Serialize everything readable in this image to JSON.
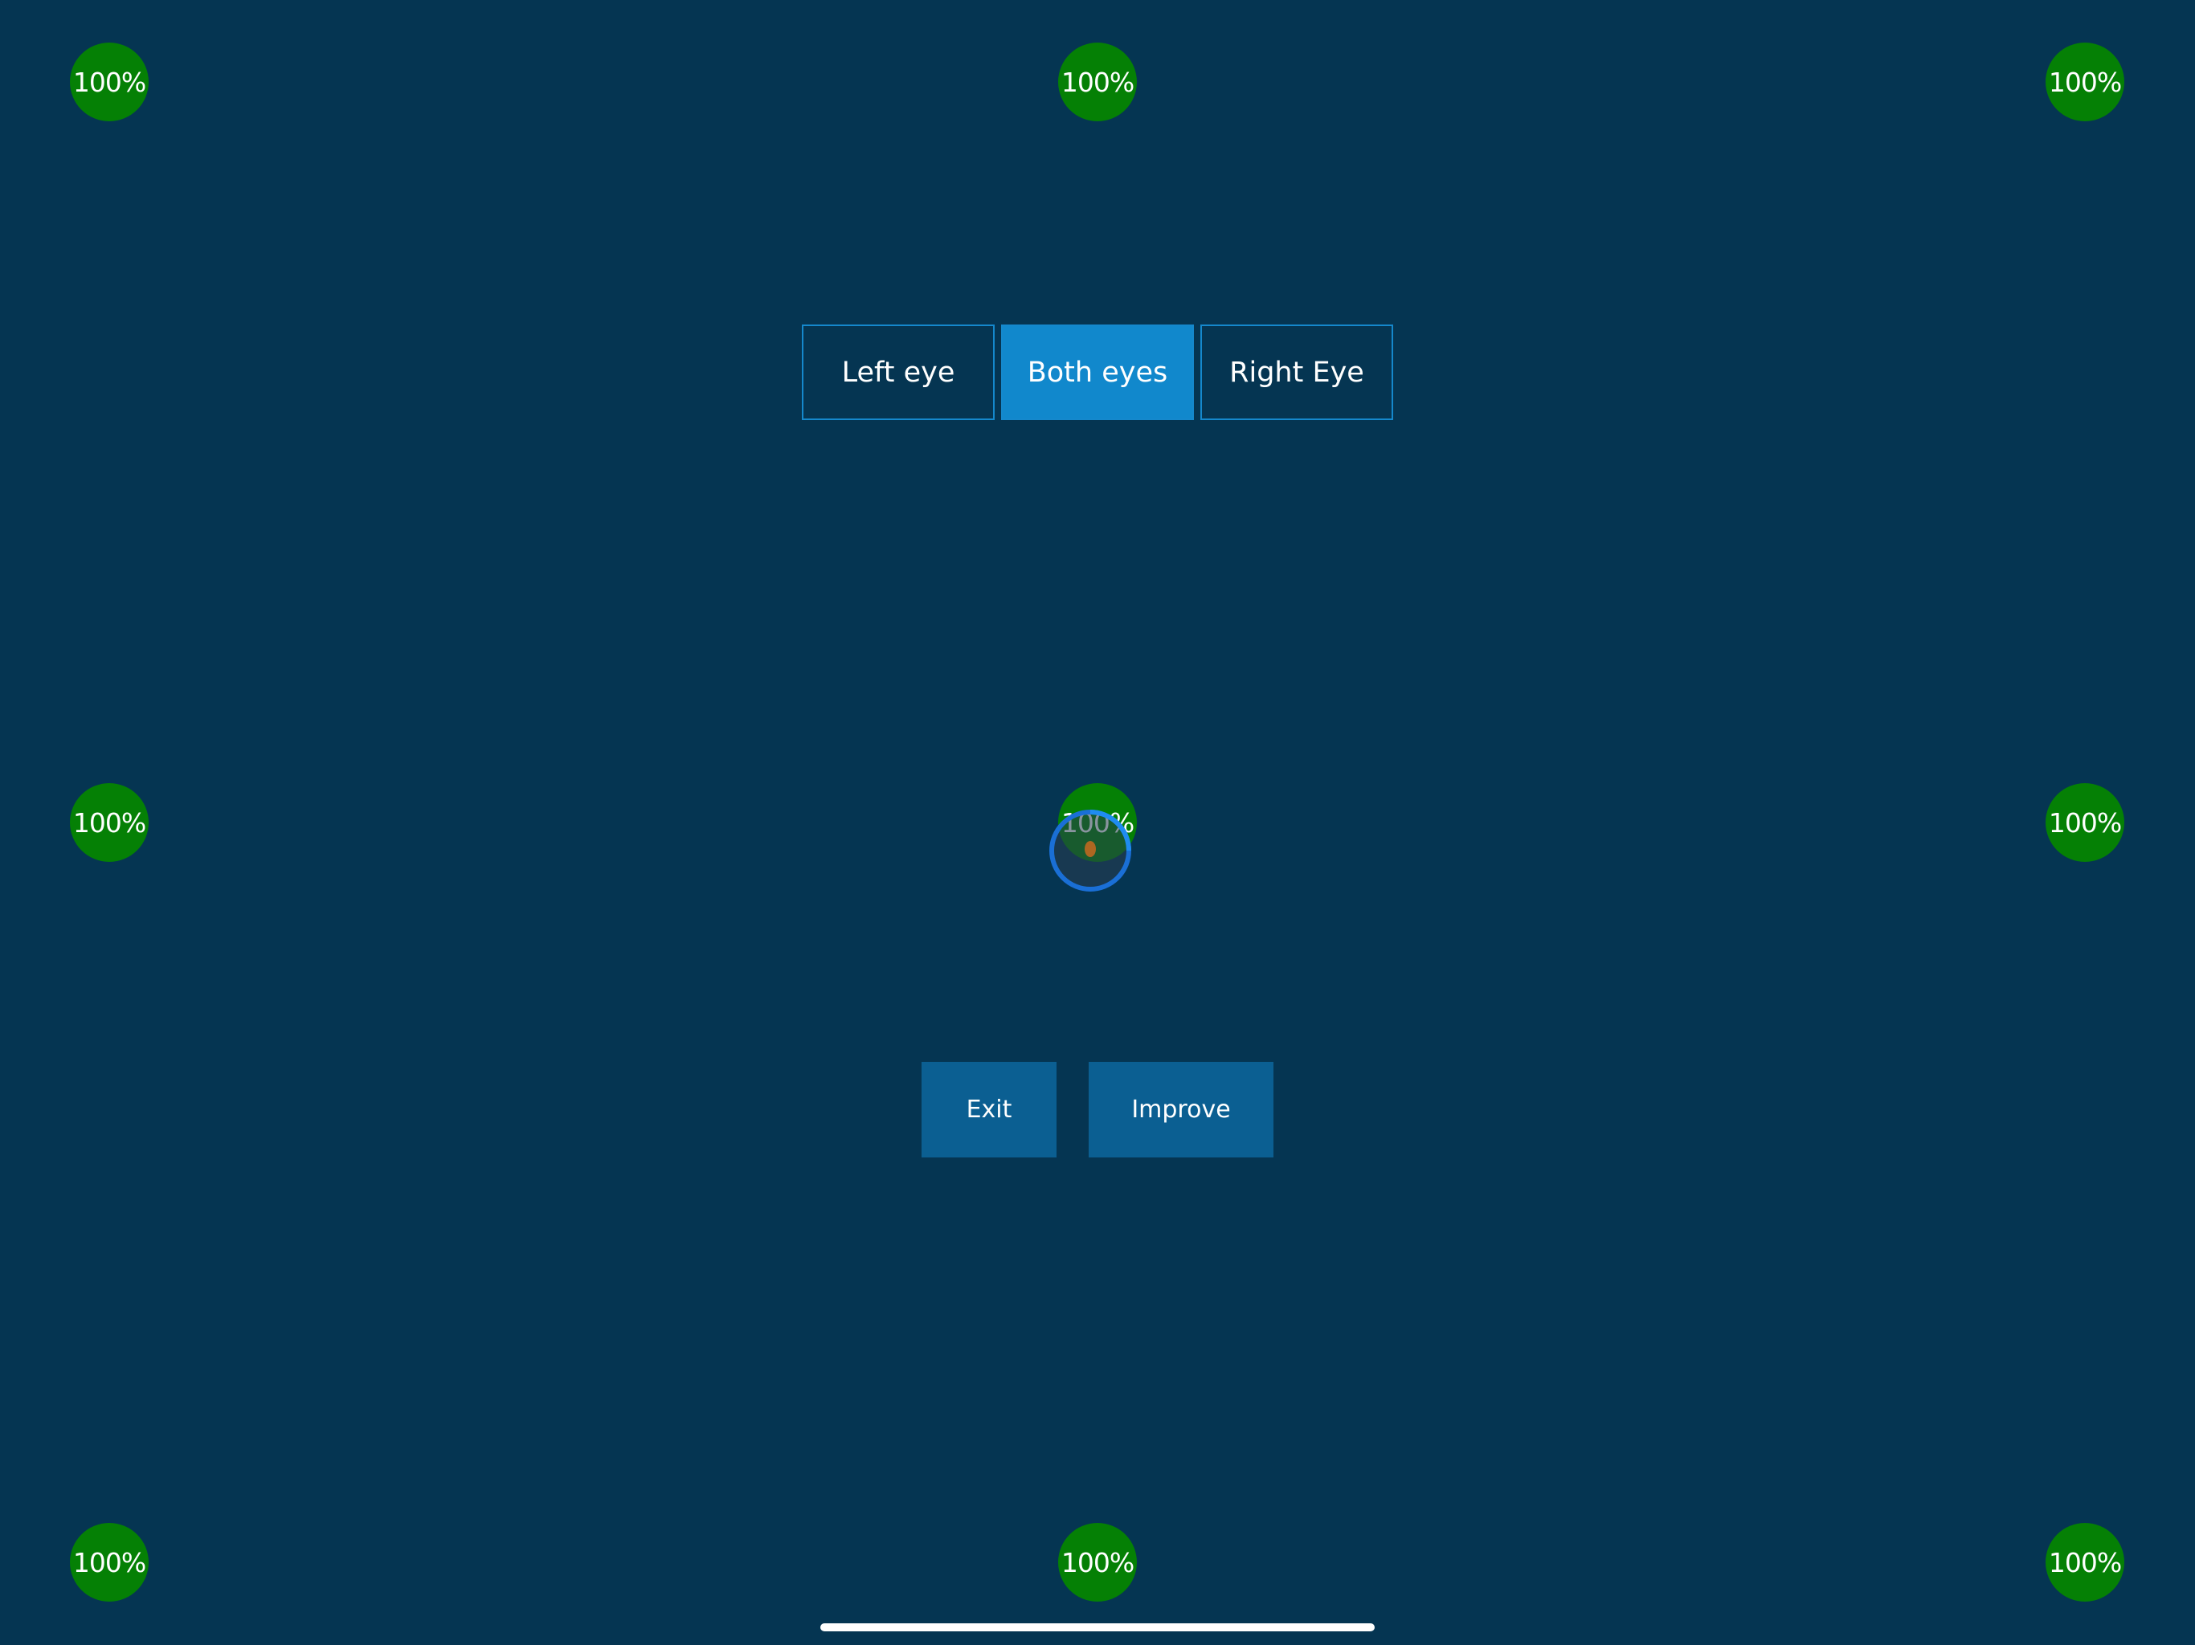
{
  "calibration": {
    "points": [
      {
        "id": "top-left",
        "label": "100%"
      },
      {
        "id": "top-center",
        "label": "100%"
      },
      {
        "id": "top-right",
        "label": "100%"
      },
      {
        "id": "middle-left",
        "label": "100%"
      },
      {
        "id": "center",
        "label": "100%"
      },
      {
        "id": "middle-right",
        "label": "100%"
      },
      {
        "id": "bottom-left",
        "label": "100%"
      },
      {
        "id": "bottom-center",
        "label": "100%"
      },
      {
        "id": "bottom-right",
        "label": "100%"
      }
    ],
    "accuracy_values": [
      100,
      100,
      100,
      100,
      100,
      100,
      100,
      100,
      100
    ],
    "point_color": "#058005"
  },
  "eye_mode": {
    "options": [
      "Left eye",
      "Both eyes",
      "Right Eye"
    ],
    "selected": "Both eyes",
    "accent_color": "#1188cc"
  },
  "actions": {
    "exit_label": "Exit",
    "improve_label": "Improve",
    "button_color": "#0b5f92"
  },
  "gaze_cursor": {
    "icon": "gaze-cursor-icon",
    "ring_color": "#1a6fd6",
    "dot_color": "#c86a1e"
  },
  "background_color": "#053552"
}
